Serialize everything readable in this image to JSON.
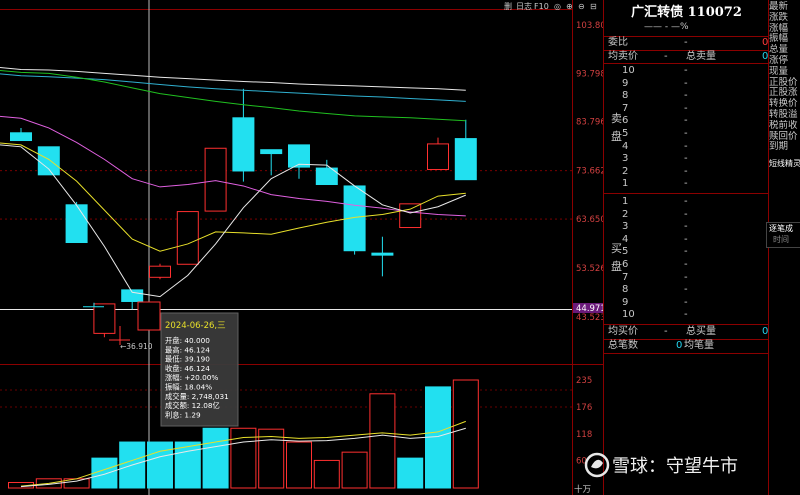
{
  "toolbar": {
    "items": [
      "删",
      "日志",
      "F10",
      "◎",
      "⊕",
      "⊖",
      "⊟"
    ]
  },
  "stock": {
    "name": "广汇转债",
    "code": "110072",
    "change_line": "—— - —%"
  },
  "quote_panel": {
    "weibi_label": "委比",
    "weibi_value": "-",
    "weibi_right": "0",
    "avg_sell_label": "均卖价",
    "avg_sell_value": "-",
    "total_sell_label": "总卖量",
    "total_sell_right": "0",
    "sell_side_label": "卖盘",
    "sell_levels": [
      "10",
      "9",
      "8",
      "7",
      "6",
      "5",
      "4",
      "3",
      "2",
      "1"
    ],
    "buy_side_label": "买盘",
    "buy_levels": [
      "1",
      "2",
      "3",
      "4",
      "5",
      "6",
      "7",
      "8",
      "9",
      "10"
    ],
    "avg_buy_label": "均买价",
    "avg_buy_value": "-",
    "total_buy_label": "总买量",
    "total_buy_right": "0",
    "total_trades_label": "总笔数",
    "total_trades_value": "0",
    "avg_trade_label": "均笔量",
    "tick_label": "逐笔成",
    "time_label": "时间"
  },
  "sidebar": {
    "items": [
      "最新",
      "涨跌",
      "涨幅",
      "振幅",
      "总量",
      "涨停",
      "现量",
      "正股价",
      "正股涨",
      "转换价",
      "转股溢",
      "税前收",
      "赎回价",
      "到期"
    ]
  },
  "sidebar_extra": "短线精灵",
  "tooltip": {
    "date": "2024-06-26,三",
    "open": "开盘: 40.000",
    "high": "最高: 46.124",
    "low": "最低: 39.190",
    "close": "收盘: 46.124",
    "change": "涨幅: +20.00%",
    "amplitude": "振幅: 18.04%",
    "volume": "成交量: 2,748,031",
    "amount": "成交额: 12.08亿",
    "interest": "利息: 1.29"
  },
  "annotations": {
    "low_marker": "←36.910",
    "vol_unit": "十万"
  },
  "watermark": "雪球：守望牛市",
  "colors": {
    "up": "#ff3030",
    "down": "#22e0f0",
    "ma_white": "#e8e8e8",
    "ma_yellow": "#e8e02a",
    "ma_magenta": "#e060e0",
    "ma_green": "#20c020",
    "ma_cyan": "#30b0d0",
    "grid": "#8b0000"
  },
  "chart_data": {
    "type": "candlestick",
    "price_axis_ticks": [
      103.801,
      93.798,
      83.796,
      73.662,
      63.65,
      53.526,
      44.971,
      43.523
    ],
    "current_price_marker": 44.971,
    "volume_axis_ticks": [
      235,
      176,
      118,
      60
    ],
    "volume_unit": "十万",
    "candles": [
      {
        "open": 81.5,
        "close": 79.9,
        "high": 82.5,
        "low": 79.9
      },
      {
        "open": 78.6,
        "close": 72.8,
        "high": 78.6,
        "low": 72.8
      },
      {
        "open": 66.6,
        "close": 58.8,
        "high": 67.2,
        "low": 58.8
      },
      {
        "open": 40.0,
        "close": 46.1,
        "high": 46.1,
        "low": 39.2
      },
      {
        "open": 49.0,
        "close": 46.6,
        "high": 49.0,
        "low": 45.0
      },
      {
        "open": 51.6,
        "close": 53.9,
        "high": 54.4,
        "low": 51.2
      },
      {
        "open": 54.3,
        "close": 65.2,
        "high": 65.2,
        "low": 54.3
      },
      {
        "open": 65.3,
        "close": 78.3,
        "high": 78.3,
        "low": 65.3
      },
      {
        "open": 84.6,
        "close": 73.6,
        "high": 90.6,
        "low": 71.4
      },
      {
        "open": 78.0,
        "close": 77.2,
        "high": 78.0,
        "low": 72.7
      },
      {
        "open": 79.0,
        "close": 74.4,
        "high": 79.0,
        "low": 72.0
      },
      {
        "open": 74.2,
        "close": 70.8,
        "high": 75.9,
        "low": 70.8
      },
      {
        "open": 70.5,
        "close": 57.1,
        "high": 70.5,
        "low": 56.3
      },
      {
        "open": 56.6,
        "close": 56.3,
        "high": 60.0,
        "low": 51.8
      },
      {
        "open": 61.9,
        "close": 66.8,
        "high": 66.8,
        "low": 61.9
      },
      {
        "open": 73.9,
        "close": 79.2,
        "high": 80.5,
        "low": 73.9
      },
      {
        "open": 80.3,
        "close": 71.8,
        "high": 84.2,
        "low": 71.8
      }
    ],
    "pre_listing_markers": [
      {
        "price": 44.9
      },
      {
        "price": 43.5
      }
    ],
    "volumes": [
      12,
      20,
      20,
      65,
      100,
      100,
      100,
      130,
      130,
      128,
      100,
      60,
      78,
      205,
      65,
      220,
      235
    ],
    "vol_up": [
      false,
      false,
      false,
      true,
      true,
      true,
      true,
      true,
      false,
      false,
      false,
      false,
      false,
      false,
      true,
      true,
      false
    ],
    "ma_lines": {
      "white": [
        78.6,
        74.0,
        66.5,
        58.0,
        48.5,
        47.6,
        52.0,
        58.5,
        66.0,
        72.0,
        75.0,
        74.8,
        70.5,
        66.6,
        64.9,
        66.2,
        68.6
      ],
      "yellow": [
        79.0,
        76.0,
        71.5,
        65.5,
        59.5,
        57.0,
        58.5,
        61.0,
        60.8,
        60.5,
        61.8,
        63.0,
        64.0,
        64.6,
        65.7,
        68.4,
        69.0
      ],
      "magenta": [
        84.5,
        82.5,
        79.5,
        76.0,
        72.0,
        70.3,
        70.8,
        71.6,
        70.5,
        68.7,
        67.9,
        67.3,
        66.5,
        65.9,
        65.1,
        64.6,
        64.3
      ],
      "green": [
        94.0,
        93.8,
        93.0,
        92.0,
        90.8,
        89.6,
        88.8,
        88.0,
        87.3,
        86.7,
        86.0,
        85.5,
        85.0,
        84.8,
        84.6,
        84.3,
        84.0
      ],
      "cyan": [
        93.3,
        93.1,
        92.8,
        92.5,
        92.0,
        91.5,
        91.0,
        90.6,
        90.3,
        90.0,
        89.7,
        89.4,
        89.1,
        88.9,
        88.6,
        88.3,
        88.0
      ],
      "white_top": [
        94.6,
        94.5,
        94.2,
        93.8,
        93.4,
        93.0,
        92.7,
        92.4,
        92.1,
        91.9,
        91.6,
        91.4,
        91.2,
        91.0,
        90.8,
        90.6,
        90.3
      ]
    },
    "volume_ma": {
      "yellow": [
        4,
        10,
        20,
        40,
        60,
        80,
        90,
        100,
        110,
        112,
        108,
        110,
        115,
        120,
        115,
        122,
        145
      ],
      "white": [
        3,
        8,
        15,
        30,
        50,
        68,
        80,
        90,
        100,
        105,
        102,
        103,
        108,
        115,
        108,
        112,
        130
      ]
    }
  }
}
